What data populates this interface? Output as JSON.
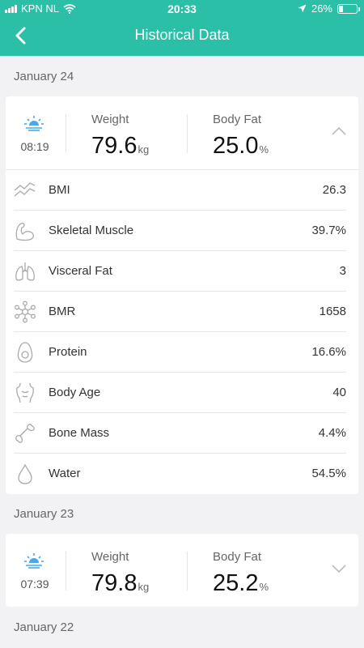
{
  "status_bar": {
    "carrier": "KPN NL",
    "time": "20:33",
    "battery": "26%",
    "battery_level": 0.26
  },
  "nav": {
    "title": "Historical Data"
  },
  "days": [
    {
      "date": "January 24",
      "time": "08:19",
      "weight_label": "Weight",
      "weight_value": "79.6",
      "weight_unit": "kg",
      "fat_label": "Body Fat",
      "fat_value": "25.0",
      "fat_unit": "%",
      "expanded": true,
      "metrics": [
        {
          "icon": "bmi-trend-icon",
          "label": "BMI",
          "value": "26.3"
        },
        {
          "icon": "muscle-arm-icon",
          "label": "Skeletal Muscle",
          "value": "39.7%"
        },
        {
          "icon": "lungs-icon",
          "label": "Visceral Fat",
          "value": "3"
        },
        {
          "icon": "molecule-icon",
          "label": "BMR",
          "value": "1658"
        },
        {
          "icon": "avocado-icon",
          "label": "Protein",
          "value": "16.6%"
        },
        {
          "icon": "torso-icon",
          "label": "Body Age",
          "value": "40"
        },
        {
          "icon": "bone-icon",
          "label": "Bone Mass",
          "value": "4.4%"
        },
        {
          "icon": "water-drop-icon",
          "label": "Water",
          "value": "54.5%"
        }
      ]
    },
    {
      "date": "January 23",
      "time": "07:39",
      "weight_label": "Weight",
      "weight_value": "79.8",
      "weight_unit": "kg",
      "fat_label": "Body Fat",
      "fat_value": "25.2",
      "fat_unit": "%",
      "expanded": false
    },
    {
      "date": "January 22"
    }
  ]
}
